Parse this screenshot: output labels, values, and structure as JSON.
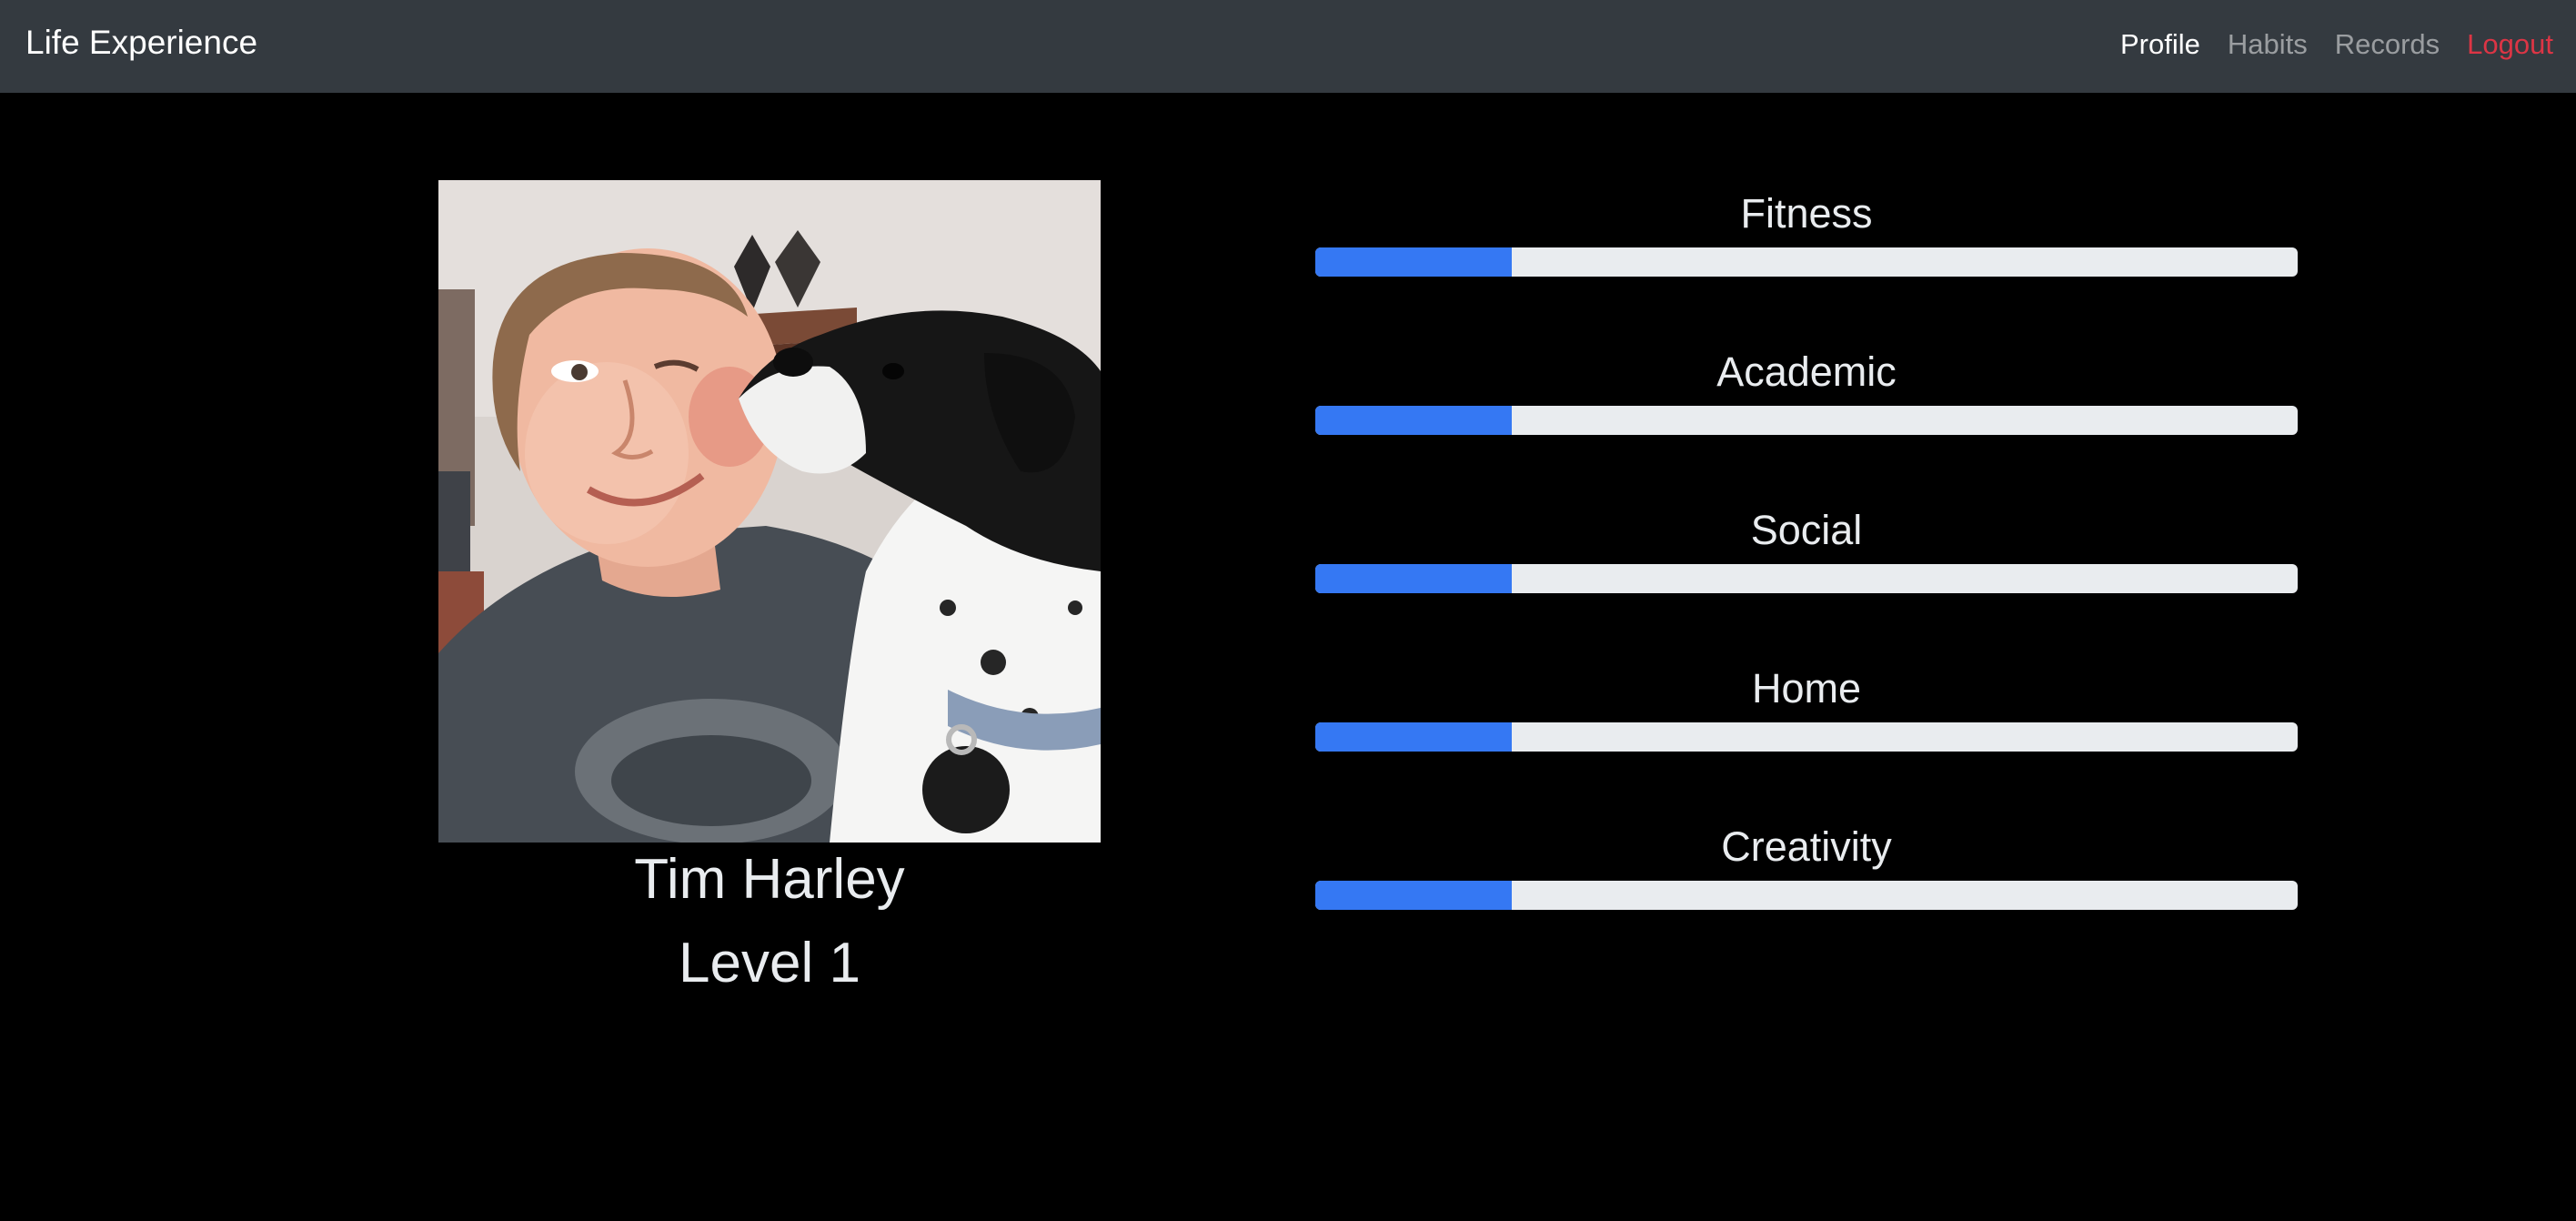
{
  "navbar": {
    "brand": "Life Experience",
    "links": [
      {
        "label": "Profile",
        "active": true
      },
      {
        "label": "Habits",
        "active": false
      },
      {
        "label": "Records",
        "active": false
      },
      {
        "label": "Logout",
        "active": false
      }
    ],
    "colors": {
      "background": "#343a40",
      "active": "#ffffff",
      "inactive": "#8c8f92",
      "logout": "#dc3545"
    }
  },
  "profile": {
    "photo_icon": "profile-photo",
    "name": "Tim Harley",
    "level": "Level 1"
  },
  "stats": [
    {
      "label": "Fitness",
      "progress": 0.2
    },
    {
      "label": "Academic",
      "progress": 0.2
    },
    {
      "label": "Social",
      "progress": 0.2
    },
    {
      "label": "Home",
      "progress": 0.2
    },
    {
      "label": "Creativity",
      "progress": 0.2
    }
  ],
  "colors": {
    "page_background": "#000000",
    "progress_fill": "#3578f3",
    "progress_track": "#e9ecef",
    "text": "#e9ecef"
  }
}
